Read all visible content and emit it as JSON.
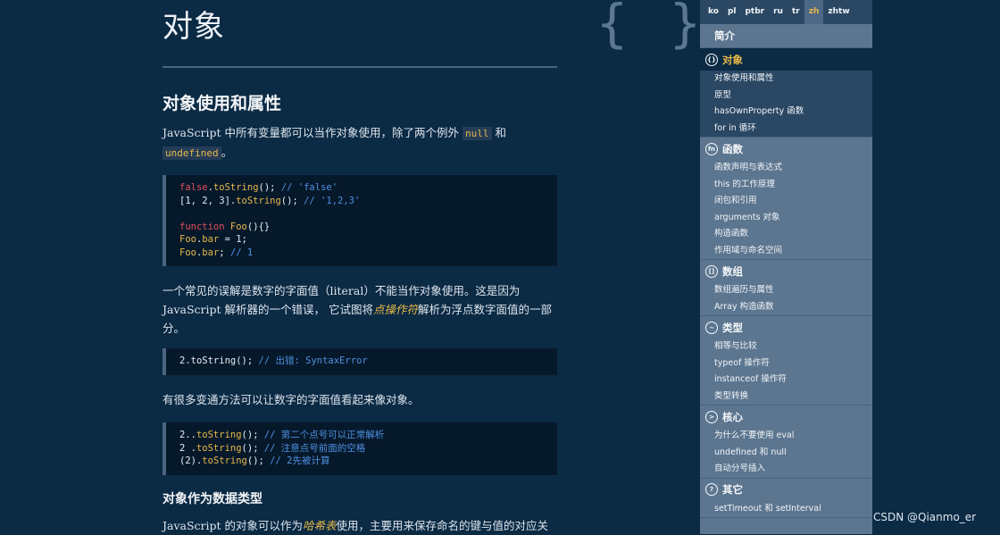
{
  "page": {
    "title": "对象",
    "braces": "{ }",
    "h2": "对象使用和属性",
    "h3": "对象作为数据类型",
    "p1_a": "JavaScript 中所有变量都可以当作对象使用，除了两个例外 ",
    "p1_null": "null",
    "p1_b": " 和",
    "p1_undefined": "undefined",
    "p1_c": "。",
    "p2_a": "一个常见的误解是数字的字面值（literal）不能当作对象使用。这是因为 JavaScript 解析器的一个错误， 它试图将",
    "p2_em": "点操作符",
    "p2_b": "解析为浮点数字面值的一部分。",
    "p3": "有很多变通方法可以让数字的字面值看起来像对象。",
    "p4_a": "JavaScript 的对象可以作为",
    "p4_em": "哈希表",
    "p4_b": "使用，主要用来保存命名的键与值的对应关",
    "code1": {
      "l1_kw": "false",
      "l1_a": ".",
      "l1_fn": "toString",
      "l1_b": "(); ",
      "l1_cm": "// 'false'",
      "l2_a": "[1, 2, 3].",
      "l2_fn": "toString",
      "l2_b": "(); ",
      "l2_cm": "// '1,2,3'",
      "l4_kw": "function",
      "l4_fn": " Foo",
      "l4_b": "(){}",
      "l5_fn": "Foo",
      "l5_a": ".",
      "l5_fn2": "bar",
      "l5_b": " = 1;",
      "l6_fn": "Foo",
      "l6_a": ".",
      "l6_fn2": "bar",
      "l6_b": "; ",
      "l6_cm": "// 1"
    },
    "code2": {
      "l1_a": "2.toString(); ",
      "l1_cm": "// 出错: SyntaxError"
    },
    "code3": {
      "l1_a": "2..",
      "l1_fn": "toString",
      "l1_b": "(); ",
      "l1_cm": "// 第二个点号可以正常解析",
      "l2_a": "2 .",
      "l2_fn": "toString",
      "l2_b": "(); ",
      "l2_cm": "// 注意点号前面的空格",
      "l3_a": "(2).",
      "l3_fn": "toString",
      "l3_b": "(); ",
      "l3_cm": "// 2先被计算"
    }
  },
  "sidebar": {
    "languages": [
      "ko",
      "pl",
      "ptbr",
      "ru",
      "tr",
      "zh",
      "zhtw"
    ],
    "active_language": "zh",
    "intro": "简介",
    "sections": [
      {
        "icon": "{}",
        "title": "对象",
        "items": [
          "对象使用和属性",
          "原型",
          "hasOwnProperty 函数",
          "for in 循环"
        ]
      },
      {
        "icon": "fn",
        "title": "函数",
        "items": [
          "函数声明与表达式",
          "this 的工作原理",
          "闭包和引用",
          "arguments 对象",
          "构造函数",
          "作用域与命名空间"
        ]
      },
      {
        "icon": "[]",
        "title": "数组",
        "items": [
          "数组遍历与属性",
          "Array 构造函数"
        ]
      },
      {
        "icon": "~",
        "title": "类型",
        "items": [
          "相等与比较",
          "typeof 操作符",
          "instanceof 操作符",
          "类型转换"
        ]
      },
      {
        "icon": ">",
        "title": "核心",
        "items": [
          "为什么不要使用 eval",
          "undefined 和 null",
          "自动分号插入"
        ]
      },
      {
        "icon": "?",
        "title": "其它",
        "items": [
          "setTimeout 和 setInterval"
        ]
      }
    ]
  },
  "watermark": "CSDN @Qianmo_er"
}
